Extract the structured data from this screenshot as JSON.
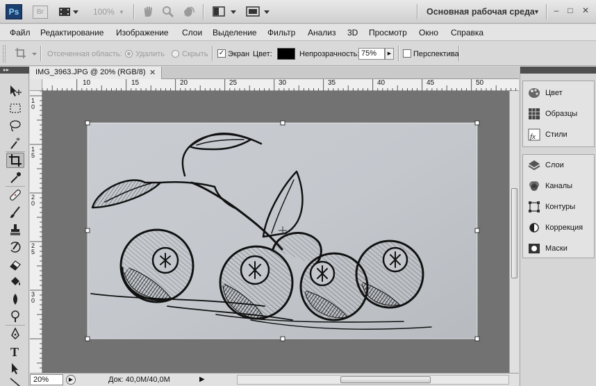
{
  "titlebar": {
    "app_logo": "Ps",
    "bridge_logo": "Br",
    "zoom": "100%",
    "workspace": "Основная рабочая среда",
    "icons": [
      "film-icon",
      "hand-icon",
      "zoom-icon",
      "rotate-icon",
      "arrange-icon",
      "screen-mode-icon"
    ]
  },
  "menu": [
    "Файл",
    "Редактирование",
    "Изображение",
    "Слои",
    "Выделение",
    "Фильтр",
    "Анализ",
    "3D",
    "Просмотр",
    "Окно",
    "Справка"
  ],
  "options": {
    "shield_label": "Отсеченная область:",
    "delete_label": "Удалить",
    "hide_label": "Скрыть",
    "screen_label": "Экран",
    "color_label": "Цвет:",
    "color_value": "#000000",
    "opacity_label": "Непрозрачность:",
    "opacity_value": "75%",
    "perspective_label": "Перспектива"
  },
  "document": {
    "tab_title": "IMG_3963.JPG @ 20% (RGB/8)",
    "tab_close": "✕",
    "ruler_h_labels": [
      "10",
      "15",
      "20",
      "25",
      "30",
      "35",
      "40",
      "45",
      "50"
    ],
    "ruler_v_labels": [
      "1\n0",
      "1\n5",
      "2\n0",
      "2\n5",
      "3\n0"
    ]
  },
  "status": {
    "zoom": "20%",
    "doc_info": "Док: 40,0M/40,0M"
  },
  "panels": {
    "group1": [
      {
        "label": "Цвет",
        "icon": "color-palette-icon"
      },
      {
        "label": "Образцы",
        "icon": "swatches-icon"
      },
      {
        "label": "Стили",
        "icon": "styles-fx-icon"
      }
    ],
    "group2": [
      {
        "label": "Слои",
        "icon": "layers-icon"
      },
      {
        "label": "Каналы",
        "icon": "channels-icon"
      },
      {
        "label": "Контуры",
        "icon": "paths-icon"
      },
      {
        "label": "Коррекция",
        "icon": "adjustments-icon"
      },
      {
        "label": "Маски",
        "icon": "masks-icon"
      }
    ]
  },
  "colors": {
    "canvas_bg": "#727272",
    "photo_paper": "#c4c8cd",
    "ps_blue": "#1b3f6e"
  }
}
